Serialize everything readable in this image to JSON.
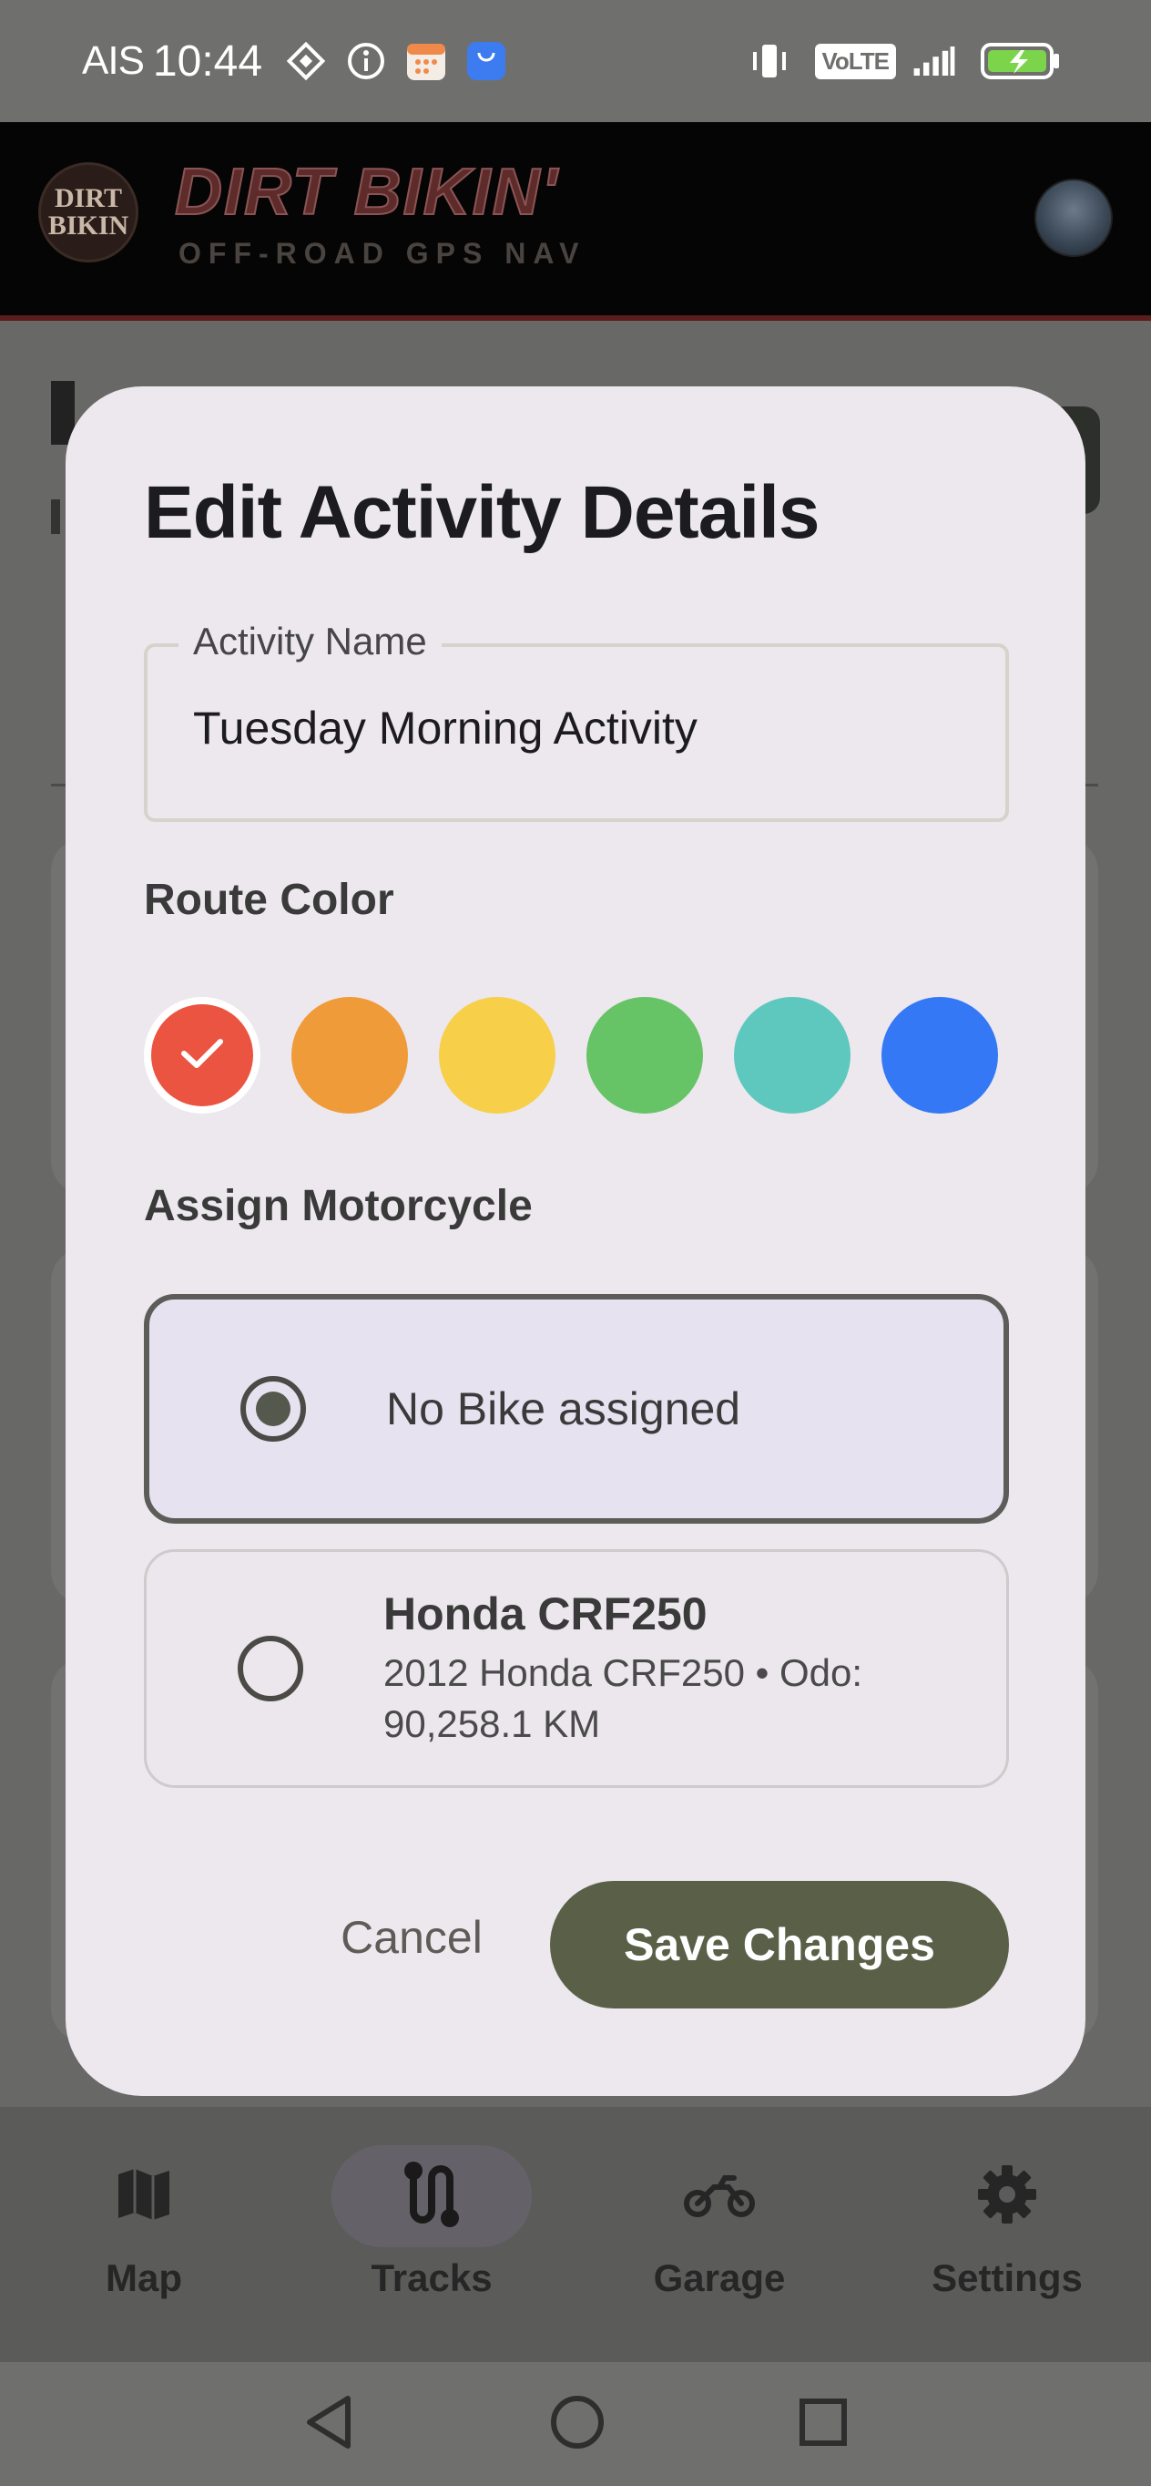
{
  "status_bar": {
    "carrier": "AIS",
    "time": "10:44",
    "network_badge": "VoLTE",
    "icons": [
      "diamond-icon",
      "info-icon",
      "calendar-icon",
      "app-market-icon",
      "vibrate-icon",
      "signal-icon",
      "battery-charging-icon"
    ]
  },
  "header": {
    "logo_line1": "DIRT",
    "logo_line2": "BIKIN",
    "title": "DIRT BIKIN'",
    "subtitle": "OFF-ROAD GPS NAV"
  },
  "dialog": {
    "title": "Edit Activity Details",
    "name_field": {
      "label": "Activity Name",
      "value": "Tuesday Morning Activity"
    },
    "route_color_label": "Route Color",
    "colors": [
      {
        "name": "red",
        "hex": "#ea5440",
        "selected": true
      },
      {
        "name": "orange",
        "hex": "#ef9b39"
      },
      {
        "name": "yellow",
        "hex": "#f7cf48"
      },
      {
        "name": "green",
        "hex": "#66c466"
      },
      {
        "name": "teal",
        "hex": "#5ec8bf"
      },
      {
        "name": "blue",
        "hex": "#3478f5"
      }
    ],
    "assign_label": "Assign Motorcycle",
    "bikes": [
      {
        "label": "No Bike assigned",
        "selected": true
      },
      {
        "title": "Honda CRF250",
        "detail": "2012 Honda CRF250 • Odo: 90,258.1 KM",
        "selected": false
      }
    ],
    "cancel_label": "Cancel",
    "save_label": "Save Changes"
  },
  "bottom_nav": {
    "items": [
      {
        "label": "Map",
        "icon": "map-icon"
      },
      {
        "label": "Tracks",
        "icon": "route-icon",
        "active": true
      },
      {
        "label": "Garage",
        "icon": "motorcycle-icon"
      },
      {
        "label": "Settings",
        "icon": "gear-icon"
      }
    ]
  },
  "system_nav": [
    "back-icon",
    "home-icon",
    "recents-icon"
  ]
}
